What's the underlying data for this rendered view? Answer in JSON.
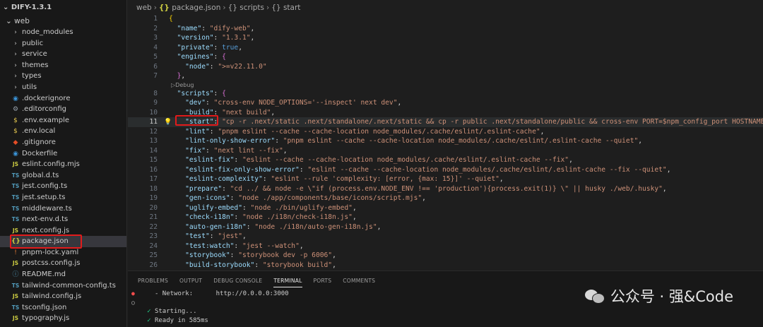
{
  "explorer": {
    "project": "DIFY-1.3.1",
    "root_folder": "web",
    "items": [
      {
        "label": "node_modules",
        "kind": "folder",
        "icon": "chevron-right-icon",
        "glyph": "›"
      },
      {
        "label": "public",
        "kind": "folder",
        "icon": "chevron-right-icon",
        "glyph": "›"
      },
      {
        "label": "service",
        "kind": "folder",
        "icon": "chevron-right-icon",
        "glyph": "›"
      },
      {
        "label": "themes",
        "kind": "folder",
        "icon": "chevron-right-icon",
        "glyph": "›"
      },
      {
        "label": "types",
        "kind": "folder",
        "icon": "chevron-right-icon",
        "glyph": "›"
      },
      {
        "label": "utils",
        "kind": "folder",
        "icon": "chevron-right-icon",
        "glyph": "›"
      },
      {
        "label": ".dockerignore",
        "kind": "file",
        "icon": "docker-icon",
        "glyph": "◉"
      },
      {
        "label": ".editorconfig",
        "kind": "file",
        "icon": "gear-icon",
        "glyph": "⚙"
      },
      {
        "label": ".env.example",
        "kind": "file",
        "icon": "dollar-icon",
        "glyph": "$"
      },
      {
        "label": ".env.local",
        "kind": "file",
        "icon": "dollar-icon",
        "glyph": "$"
      },
      {
        "label": ".gitignore",
        "kind": "file",
        "icon": "git-icon",
        "glyph": "◆"
      },
      {
        "label": "Dockerfile",
        "kind": "file",
        "icon": "docker-icon",
        "glyph": "◉"
      },
      {
        "label": "eslint.config.mjs",
        "kind": "file",
        "icon": "js-file-icon",
        "glyph": "JS"
      },
      {
        "label": "global.d.ts",
        "kind": "file",
        "icon": "ts-file-icon",
        "glyph": "TS"
      },
      {
        "label": "jest.config.ts",
        "kind": "file",
        "icon": "ts-file-icon",
        "glyph": "TS"
      },
      {
        "label": "jest.setup.ts",
        "kind": "file",
        "icon": "ts-file-icon",
        "glyph": "TS"
      },
      {
        "label": "middleware.ts",
        "kind": "file",
        "icon": "ts-file-icon",
        "glyph": "TS"
      },
      {
        "label": "next-env.d.ts",
        "kind": "file",
        "icon": "ts-file-icon",
        "glyph": "TS"
      },
      {
        "label": "next.config.js",
        "kind": "file",
        "icon": "js-file-icon",
        "glyph": "JS"
      },
      {
        "label": "package.json",
        "kind": "file",
        "icon": "json-file-icon",
        "glyph": "{}",
        "selected": true
      },
      {
        "label": "pnpm-lock.yaml",
        "kind": "file",
        "icon": "yaml-file-icon",
        "glyph": "!"
      },
      {
        "label": "postcss.config.js",
        "kind": "file",
        "icon": "js-file-icon",
        "glyph": "JS"
      },
      {
        "label": "README.md",
        "kind": "file",
        "icon": "info-icon",
        "glyph": "ⓘ"
      },
      {
        "label": "tailwind-common-config.ts",
        "kind": "file",
        "icon": "ts-file-icon",
        "glyph": "TS"
      },
      {
        "label": "tailwind.config.js",
        "kind": "file",
        "icon": "js-file-icon",
        "glyph": "JS"
      },
      {
        "label": "tsconfig.json",
        "kind": "file",
        "icon": "ts-file-icon",
        "glyph": "TS"
      },
      {
        "label": "typography.js",
        "kind": "file",
        "icon": "js-file-icon",
        "glyph": "JS"
      }
    ]
  },
  "breadcrumb": {
    "parts": [
      "web",
      "package.json",
      "scripts",
      "start"
    ],
    "brace": "{}",
    "sep": "›"
  },
  "editor": {
    "codelens": "▷Debug",
    "lines": [
      {
        "n": "1",
        "segs": [
          [
            "b1",
            "{"
          ]
        ]
      },
      {
        "n": "2",
        "segs": [
          [
            "p",
            "  "
          ],
          [
            "k",
            "\"name\""
          ],
          [
            "p",
            ": "
          ],
          [
            "s",
            "\"dify-web\""
          ],
          [
            "p",
            ","
          ]
        ]
      },
      {
        "n": "3",
        "segs": [
          [
            "p",
            "  "
          ],
          [
            "k",
            "\"version\""
          ],
          [
            "p",
            ": "
          ],
          [
            "s",
            "\"1.3.1\""
          ],
          [
            "p",
            ","
          ]
        ]
      },
      {
        "n": "4",
        "segs": [
          [
            "p",
            "  "
          ],
          [
            "k",
            "\"private\""
          ],
          [
            "p",
            ": "
          ],
          [
            "kw",
            "true"
          ],
          [
            "p",
            ","
          ]
        ]
      },
      {
        "n": "5",
        "segs": [
          [
            "p",
            "  "
          ],
          [
            "k",
            "\"engines\""
          ],
          [
            "p",
            ": "
          ],
          [
            "b2",
            "{"
          ]
        ]
      },
      {
        "n": "6",
        "segs": [
          [
            "p",
            "    "
          ],
          [
            "k",
            "\"node\""
          ],
          [
            "p",
            ": "
          ],
          [
            "s",
            "\">=v22.11.0\""
          ]
        ]
      },
      {
        "n": "7",
        "segs": [
          [
            "p",
            "  "
          ],
          [
            "b2",
            "}"
          ],
          [
            "p",
            ","
          ]
        ]
      },
      {
        "n": "8",
        "segs": [
          [
            "p",
            "  "
          ],
          [
            "k",
            "\"scripts\""
          ],
          [
            "p",
            ": "
          ],
          [
            "b2",
            "{"
          ]
        ]
      },
      {
        "n": "9",
        "segs": [
          [
            "p",
            "    "
          ],
          [
            "k",
            "\"dev\""
          ],
          [
            "p",
            ": "
          ],
          [
            "s",
            "\"cross-env NODE_OPTIONS='--inspect' next dev\""
          ],
          [
            "p",
            ","
          ]
        ]
      },
      {
        "n": "10",
        "segs": [
          [
            "p",
            "    "
          ],
          [
            "k",
            "\"build\""
          ],
          [
            "p",
            ": "
          ],
          [
            "s",
            "\"next build\""
          ],
          [
            "p",
            ","
          ]
        ]
      },
      {
        "n": "11",
        "segs": [
          [
            "p",
            "    "
          ],
          [
            "k",
            "\"start\""
          ],
          [
            "p",
            ": "
          ],
          [
            "s",
            "\"cp -r .next/static .next/standalone/.next/static && cp -r public .next/standalone/public && cross-env PORT=$npm_config_port HOSTNAME=$npm_config_host node .next/standalone/server.js\""
          ],
          [
            "p",
            ","
          ]
        ]
      },
      {
        "n": "12",
        "segs": [
          [
            "p",
            "    "
          ],
          [
            "k",
            "\"lint\""
          ],
          [
            "p",
            ": "
          ],
          [
            "s",
            "\"pnpm eslint --cache --cache-location node_modules/.cache/eslint/.eslint-cache\""
          ],
          [
            "p",
            ","
          ]
        ]
      },
      {
        "n": "13",
        "segs": [
          [
            "p",
            "    "
          ],
          [
            "k",
            "\"lint-only-show-error\""
          ],
          [
            "p",
            ": "
          ],
          [
            "s",
            "\"pnpm eslint --cache --cache-location node_modules/.cache/eslint/.eslint-cache --quiet\""
          ],
          [
            "p",
            ","
          ]
        ]
      },
      {
        "n": "14",
        "segs": [
          [
            "p",
            "    "
          ],
          [
            "k",
            "\"fix\""
          ],
          [
            "p",
            ": "
          ],
          [
            "s",
            "\"next lint --fix\""
          ],
          [
            "p",
            ","
          ]
        ]
      },
      {
        "n": "15",
        "segs": [
          [
            "p",
            "    "
          ],
          [
            "k",
            "\"eslint-fix\""
          ],
          [
            "p",
            ": "
          ],
          [
            "s",
            "\"eslint --cache --cache-location node_modules/.cache/eslint/.eslint-cache --fix\""
          ],
          [
            "p",
            ","
          ]
        ]
      },
      {
        "n": "16",
        "segs": [
          [
            "p",
            "    "
          ],
          [
            "k",
            "\"eslint-fix-only-show-error\""
          ],
          [
            "p",
            ": "
          ],
          [
            "s",
            "\"eslint --cache --cache-location node_modules/.cache/eslint/.eslint-cache --fix --quiet\""
          ],
          [
            "p",
            ","
          ]
        ]
      },
      {
        "n": "17",
        "segs": [
          [
            "p",
            "    "
          ],
          [
            "k",
            "\"eslint-complexity\""
          ],
          [
            "p",
            ": "
          ],
          [
            "s",
            "\"eslint --rule 'complexity: [error, {max: 15}]' --quiet\""
          ],
          [
            "p",
            ","
          ]
        ]
      },
      {
        "n": "18",
        "segs": [
          [
            "p",
            "    "
          ],
          [
            "k",
            "\"prepare\""
          ],
          [
            "p",
            ": "
          ],
          [
            "s",
            "\"cd ../ && node -e \\\"if (process.env.NODE_ENV !== 'production'){process.exit(1)} \\\" || husky ./web/.husky\""
          ],
          [
            "p",
            ","
          ]
        ]
      },
      {
        "n": "19",
        "segs": [
          [
            "p",
            "    "
          ],
          [
            "k",
            "\"gen-icons\""
          ],
          [
            "p",
            ": "
          ],
          [
            "s",
            "\"node ./app/components/base/icons/script.mjs\""
          ],
          [
            "p",
            ","
          ]
        ]
      },
      {
        "n": "20",
        "segs": [
          [
            "p",
            "    "
          ],
          [
            "k",
            "\"uglify-embed\""
          ],
          [
            "p",
            ": "
          ],
          [
            "s",
            "\"node ./bin/uglify-embed\""
          ],
          [
            "p",
            ","
          ]
        ]
      },
      {
        "n": "21",
        "segs": [
          [
            "p",
            "    "
          ],
          [
            "k",
            "\"check-i18n\""
          ],
          [
            "p",
            ": "
          ],
          [
            "s",
            "\"node ./i18n/check-i18n.js\""
          ],
          [
            "p",
            ","
          ]
        ]
      },
      {
        "n": "22",
        "segs": [
          [
            "p",
            "    "
          ],
          [
            "k",
            "\"auto-gen-i18n\""
          ],
          [
            "p",
            ": "
          ],
          [
            "s",
            "\"node ./i18n/auto-gen-i18n.js\""
          ],
          [
            "p",
            ","
          ]
        ]
      },
      {
        "n": "23",
        "segs": [
          [
            "p",
            "    "
          ],
          [
            "k",
            "\"test\""
          ],
          [
            "p",
            ": "
          ],
          [
            "s",
            "\"jest\""
          ],
          [
            "p",
            ","
          ]
        ]
      },
      {
        "n": "24",
        "segs": [
          [
            "p",
            "    "
          ],
          [
            "k",
            "\"test:watch\""
          ],
          [
            "p",
            ": "
          ],
          [
            "s",
            "\"jest --watch\""
          ],
          [
            "p",
            ","
          ]
        ]
      },
      {
        "n": "25",
        "segs": [
          [
            "p",
            "    "
          ],
          [
            "k",
            "\"storybook\""
          ],
          [
            "p",
            ": "
          ],
          [
            "s",
            "\"storybook dev -p 6006\""
          ],
          [
            "p",
            ","
          ]
        ]
      },
      {
        "n": "26",
        "segs": [
          [
            "p",
            "    "
          ],
          [
            "k",
            "\"build-storybook\""
          ],
          [
            "p",
            ": "
          ],
          [
            "s",
            "\"storybook build\""
          ],
          [
            "p",
            ","
          ]
        ]
      }
    ]
  },
  "panel": {
    "tabs": [
      "PROBLEMS",
      "OUTPUT",
      "DEBUG CONSOLE",
      "TERMINAL",
      "PORTS",
      "COMMENTS"
    ],
    "active_tab": "TERMINAL",
    "terminal": {
      "network_label": "- Network:",
      "network_url": "http://0.0.0.0:3000",
      "starting": "Starting...",
      "ready": "Ready in 585ms",
      "check": "✓"
    }
  },
  "watermark": {
    "text": "公众号 · 强&Code"
  }
}
